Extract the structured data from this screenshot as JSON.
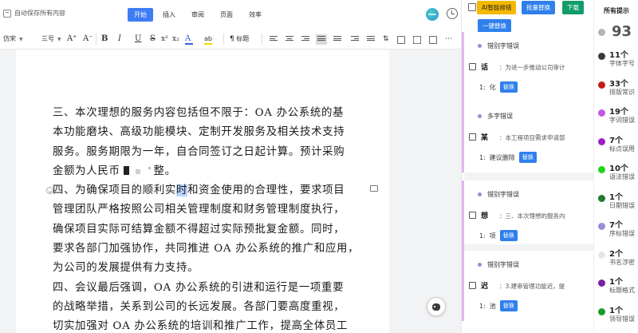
{
  "topbar": {
    "autosave": "自动保存所有内容",
    "tabs": [
      "开始",
      "插入",
      "审阅",
      "页面",
      "效率"
    ],
    "active_tab": "开始"
  },
  "toolbar": {
    "font_name": "仿宋",
    "font_size": "三号",
    "grow": "A⁺",
    "shrink": "A⁻",
    "bold": "B",
    "italic": "I",
    "underline": "U",
    "strike": "S",
    "superscript": "x²",
    "subscript": "x₂",
    "font_color": "A",
    "highlight": "ab",
    "heading": "标题",
    "colors": {
      "font_color": "#2b66d9",
      "highlight": "#f5d800"
    }
  },
  "document": {
    "lines": [
      "三、本次理想的服务内容包括但不限于：OA 办公系统的基",
      "本功能磨块、高级功能模块、定制开发服务及相关技术支持",
      "服务。服务期限为一年，自合同签订之日起计算。预计采购",
      "金额为人民币",
      "整。",
      "四、为确保项目的顺利实",
      "时",
      "和资金使用的合理性，要求项目",
      "管理团队严格按照公司相关管理制度和财务管理制度执行，",
      "确保项目实际可结算金额不得超过实际预批复金额。同时，",
      "要求各部门加强协作，共同推进 OA 办公系统的推广和应用，",
      "为公司的发展提供有力支持。",
      "四、会议最后强调，OA 办公系统的引进和运行是一项重要",
      "的战略举措，关系到公司的长远发展。各部门要高度重视，",
      "切实加强对 OA 办公系统的培训和推广工作，提高全体员工"
    ]
  },
  "panel": {
    "buttons": {
      "ai_check": "AI智能排错",
      "batch_replace": "批量替换",
      "download": "下载",
      "one_key_replace": "一键替换"
    },
    "cards": [
      {
        "type": "错别字错误",
        "word": "话",
        "context": "：为进一步推动公司审计",
        "index": "1:",
        "suggestion": "化",
        "button": "替换"
      },
      {
        "type": "多字错误",
        "word": "某",
        "context": "：本工程项目需求申请部",
        "index": "1:",
        "suggestion": "建议删除",
        "button": "替换"
      },
      {
        "type": "错别字错误",
        "word": "想",
        "context": "：三、本次理想的服务内",
        "index": "1:",
        "suggestion": "项",
        "button": "替换"
      },
      {
        "type": "错别字错误",
        "word": "迟",
        "context": "：3.建审管理功能迟，提",
        "index": "1:",
        "suggestion": "池",
        "button": "替换"
      }
    ]
  },
  "summary": {
    "title": "所有提示",
    "total": "93",
    "items": [
      {
        "count": "11个",
        "label": "字体字号",
        "color": "#3a3a3a"
      },
      {
        "count": "33个",
        "label": "排版常识",
        "color": "#c21a1a"
      },
      {
        "count": "19个",
        "label": "字词错误",
        "color": "#c25be0"
      },
      {
        "count": "7个",
        "label": "标点误用",
        "color": "#a01ec8"
      },
      {
        "count": "10个",
        "label": "语法错误",
        "color": "#1fd31f"
      },
      {
        "count": "1个",
        "label": "日期错误",
        "color": "#1e7e2e"
      },
      {
        "count": "7个",
        "label": "序标错误",
        "color": "#9c8cd8"
      },
      {
        "count": "2个",
        "label": "书名涉密",
        "color": "#e6e6e6"
      },
      {
        "count": "1个",
        "label": "标题格式",
        "color": "#7a1f9e"
      },
      {
        "count": "1个",
        "label": "领导错误",
        "color": "#1a9a2a"
      }
    ]
  }
}
